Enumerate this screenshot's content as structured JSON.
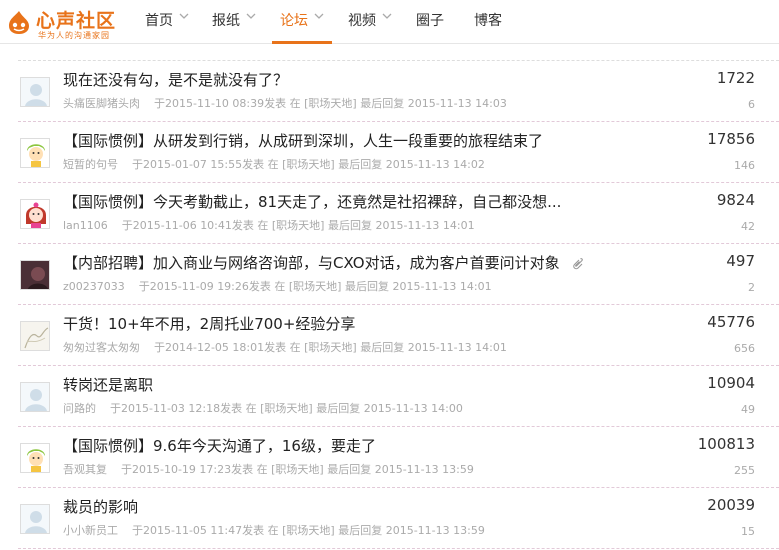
{
  "brand": {
    "name": "心声社区",
    "slogan": "华为人的沟通家园",
    "color": "#e8731a"
  },
  "nav": [
    {
      "label": "首页",
      "has_dropdown": true,
      "active": false
    },
    {
      "label": "报纸",
      "has_dropdown": true,
      "active": false
    },
    {
      "label": "论坛",
      "has_dropdown": true,
      "active": true
    },
    {
      "label": "视频",
      "has_dropdown": true,
      "active": false
    },
    {
      "label": "圈子",
      "has_dropdown": false,
      "active": false
    },
    {
      "label": "博客",
      "has_dropdown": false,
      "active": false
    }
  ],
  "threads": [
    {
      "title": "现在还没有勾，是不是就没有了？",
      "author": "头痛医脚猪头肉",
      "posted": "于2015-11-10 08:39发表",
      "section": "在 [职场天地]",
      "last_reply": "最后回复 2015-11-13 14:03",
      "views": "1722",
      "replies": "6",
      "avatar": "default-avatar-icon",
      "attachment": false
    },
    {
      "title": "【国际惯例】从研发到行销，从成研到深圳，人生一段重要的旅程结束了",
      "author": "短暂的句号",
      "posted": "于2015-01-07 15:55发表",
      "section": "在 [职场天地]",
      "last_reply": "最后回复 2015-11-13 14:02",
      "views": "17856",
      "replies": "146",
      "avatar": "cartoon-kid-avatar-icon",
      "attachment": false
    },
    {
      "title": "【国际惯例】今天考勤截止，81天走了，还竟然是社招裸辞，自己都没想...",
      "author": "lan1106",
      "posted": "于2015-11-06 10:41发表",
      "section": "在 [职场天地]",
      "last_reply": "最后回复 2015-11-13 14:01",
      "views": "9824",
      "replies": "42",
      "avatar": "cartoon-girl-avatar-icon",
      "attachment": false
    },
    {
      "title": "【内部招聘】加入商业与网络咨询部，与CXO对话，成为客户首要问计对象",
      "author": "z00237033",
      "posted": "于2015-11-09 19:26发表",
      "section": "在 [职场天地]",
      "last_reply": "最后回复 2015-11-13 14:01",
      "views": "497",
      "replies": "2",
      "avatar": "dark-photo-avatar-icon",
      "attachment": true
    },
    {
      "title": "干货！10+年不用，2周托业700+经验分享",
      "author": "匆匆过客太匆匆",
      "posted": "于2014-12-05 18:01发表",
      "section": "在 [职场天地]",
      "last_reply": "最后回复 2015-11-13 14:01",
      "views": "45776",
      "replies": "656",
      "avatar": "sketch-avatar-icon",
      "attachment": false
    },
    {
      "title": "转岗还是离职",
      "author": "问路的",
      "posted": "于2015-11-03 12:18发表",
      "section": "在 [职场天地]",
      "last_reply": "最后回复 2015-11-13 14:00",
      "views": "10904",
      "replies": "49",
      "avatar": "default-avatar-icon",
      "attachment": false
    },
    {
      "title": "【国际惯例】9.6年今天沟通了，16级，要走了",
      "author": "吾观其复",
      "posted": "于2015-10-19 17:23发表",
      "section": "在 [职场天地]",
      "last_reply": "最后回复 2015-11-13 13:59",
      "views": "100813",
      "replies": "255",
      "avatar": "cartoon-kid-avatar-icon",
      "attachment": false
    },
    {
      "title": "裁员的影响",
      "author": "小小新员工",
      "posted": "于2015-11-05 11:47发表",
      "section": "在 [职场天地]",
      "last_reply": "最后回复 2015-11-13 13:59",
      "views": "20039",
      "replies": "15",
      "avatar": "default-avatar-icon",
      "attachment": false
    }
  ]
}
